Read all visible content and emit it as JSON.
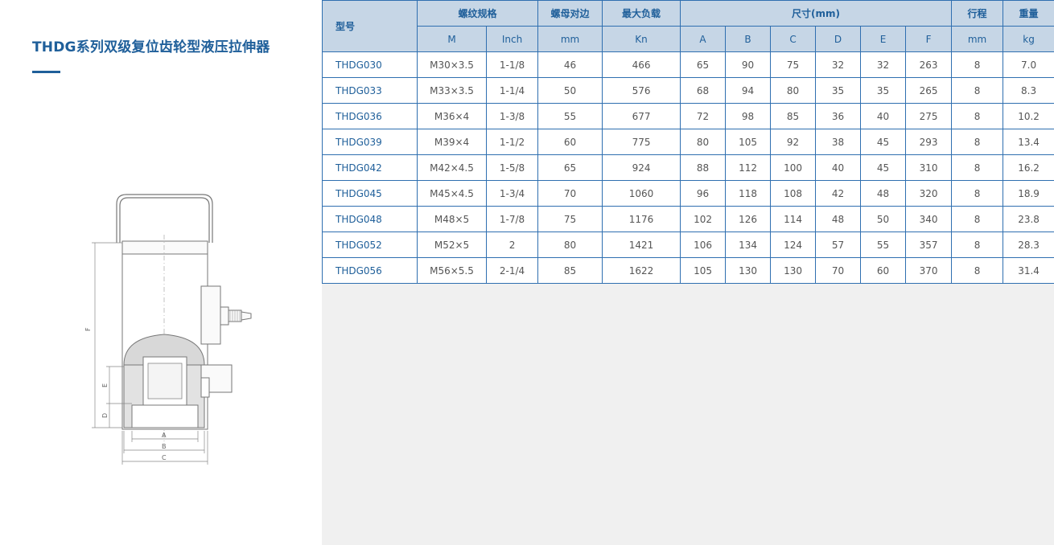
{
  "page": {
    "title": "THDG系列双级复位齿轮型液压拉伸器"
  },
  "drawing": {
    "dim_labels": {
      "A": "A",
      "B": "B",
      "C": "C",
      "D": "D",
      "E": "E",
      "F": "F"
    }
  },
  "table": {
    "head": {
      "model": "型号",
      "thread_group": "螺纹规格",
      "nut_flat": "螺母对边",
      "max_load": "最大负载",
      "dims_group": "尺寸(mm)",
      "stroke": "行程",
      "weight": "重量"
    },
    "subhead": {
      "m": "M",
      "inch": "Inch",
      "nut_unit": "mm",
      "load_unit": "Kn",
      "a": "A",
      "b": "B",
      "c": "C",
      "d": "D",
      "e": "E",
      "f": "F",
      "stroke_unit": "mm",
      "weight_unit": "kg"
    },
    "rows": [
      [
        "THDG030",
        "M30×3.5",
        "1-1/8",
        "46",
        "466",
        "65",
        "90",
        "75",
        "32",
        "32",
        "263",
        "8",
        "7.0"
      ],
      [
        "THDG033",
        "M33×3.5",
        "1-1/4",
        "50",
        "576",
        "68",
        "94",
        "80",
        "35",
        "35",
        "265",
        "8",
        "8.3"
      ],
      [
        "THDG036",
        "M36×4",
        "1-3/8",
        "55",
        "677",
        "72",
        "98",
        "85",
        "36",
        "40",
        "275",
        "8",
        "10.2"
      ],
      [
        "THDG039",
        "M39×4",
        "1-1/2",
        "60",
        "775",
        "80",
        "105",
        "92",
        "38",
        "45",
        "293",
        "8",
        "13.4"
      ],
      [
        "THDG042",
        "M42×4.5",
        "1-5/8",
        "65",
        "924",
        "88",
        "112",
        "100",
        "40",
        "45",
        "310",
        "8",
        "16.2"
      ],
      [
        "THDG045",
        "M45×4.5",
        "1-3/4",
        "70",
        "1060",
        "96",
        "118",
        "108",
        "42",
        "48",
        "320",
        "8",
        "18.9"
      ],
      [
        "THDG048",
        "M48×5",
        "1-7/8",
        "75",
        "1176",
        "102",
        "126",
        "114",
        "48",
        "50",
        "340",
        "8",
        "23.8"
      ],
      [
        "THDG052",
        "M52×5",
        "2",
        "80",
        "1421",
        "106",
        "134",
        "124",
        "57",
        "55",
        "357",
        "8",
        "28.3"
      ],
      [
        "THDG056",
        "M56×5.5",
        "2-1/4",
        "85",
        "1622",
        "105",
        "130",
        "130",
        "70",
        "60",
        "370",
        "8",
        "31.4"
      ]
    ]
  }
}
